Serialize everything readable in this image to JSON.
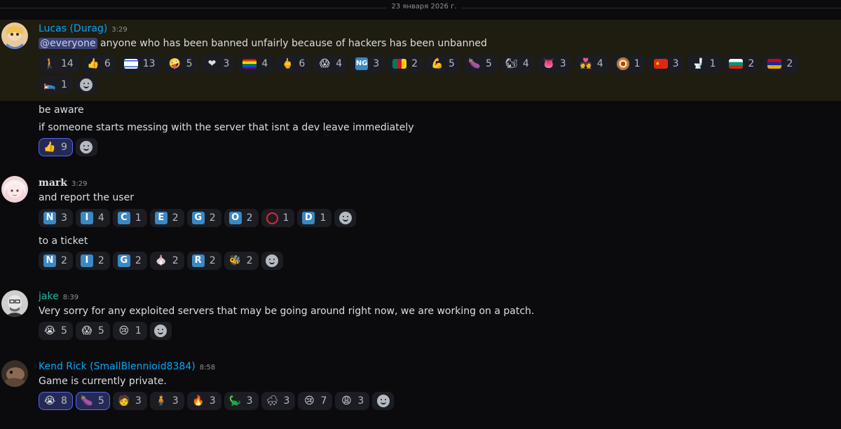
{
  "date_divider": "23 января 2026 г.",
  "colors": {
    "accent": "#5865f2",
    "highlight_bg": "#1f1c10",
    "user_blue": "#00a8fc",
    "user_green": "#1abc9c",
    "mark_color": "#dbdee1"
  },
  "messages": [
    {
      "author": "Lucas (Durag)",
      "time": "3:29",
      "avatar_icon": "avatar-lucas",
      "lines": [
        {
          "mention": "@everyone",
          "text": " anyone who has been banned unfairly because of hackers has been unbanned"
        }
      ],
      "reactions": [
        {
          "emoji": "person-walking-icon",
          "glyph": "🚶",
          "count": "14"
        },
        {
          "emoji": "thumbs-up-icon",
          "glyph": "👍",
          "count": "6"
        },
        {
          "emoji": "israel-flag-icon",
          "glyph": "",
          "count": "13"
        },
        {
          "emoji": "face-icon",
          "glyph": "🤪",
          "count": "5"
        },
        {
          "emoji": "heart-icon",
          "glyph": "❤",
          "count": "3"
        },
        {
          "emoji": "rainbow-flag-icon",
          "glyph": "",
          "count": "4"
        },
        {
          "emoji": "middle-finger-icon",
          "glyph": "🖕",
          "count": "6"
        },
        {
          "emoji": "screaming-face-icon",
          "glyph": "😱",
          "count": "4"
        },
        {
          "emoji": "ng-button-icon",
          "glyph": "NG",
          "count": "3"
        },
        {
          "emoji": "cameroon-flag-icon",
          "glyph": "",
          "count": "2"
        },
        {
          "emoji": "muscle-icon",
          "glyph": "💪",
          "count": "5"
        },
        {
          "emoji": "eggplant-icon",
          "glyph": "🍆",
          "count": "5"
        },
        {
          "emoji": "squirrel-icon",
          "glyph": "🐿",
          "count": "4"
        },
        {
          "emoji": "tongue-icon",
          "glyph": "👅",
          "count": "3"
        },
        {
          "emoji": "couple-heart-icon",
          "glyph": "💑",
          "count": "4"
        },
        {
          "emoji": "target-icon",
          "glyph": "◎",
          "count": "1"
        },
        {
          "emoji": "china-flag-icon",
          "glyph": "",
          "count": "3"
        },
        {
          "emoji": "toilet-icon",
          "glyph": "🚽",
          "count": "1"
        },
        {
          "emoji": "bulgaria-flag-icon",
          "glyph": "",
          "count": "2"
        },
        {
          "emoji": "armenia-flag-icon",
          "glyph": "",
          "count": "2"
        },
        {
          "emoji": "bed-icon",
          "glyph": "🛌",
          "count": "1"
        }
      ]
    },
    {
      "lines": [
        {
          "text": "be aware"
        },
        {
          "text": "if someone starts messing with the server that isnt a dev leave immediately"
        }
      ],
      "reactions": [
        {
          "emoji": "thumbs-up-icon",
          "glyph": "👍",
          "count": "9",
          "active": true
        }
      ]
    },
    {
      "author": "mark",
      "time": "3:29",
      "lines": [
        {
          "text": "and report the user"
        }
      ],
      "reactions": [
        {
          "emoji": "letter-n-icon",
          "glyph": "N",
          "count": "3"
        },
        {
          "emoji": "letter-i-icon",
          "glyph": "I",
          "count": "4"
        },
        {
          "emoji": "letter-c-icon",
          "glyph": "C",
          "count": "1"
        },
        {
          "emoji": "letter-e-icon",
          "glyph": "E",
          "count": "2"
        },
        {
          "emoji": "letter-g-icon",
          "glyph": "G",
          "count": "2"
        },
        {
          "emoji": "letter-o-icon",
          "glyph": "O",
          "count": "2"
        },
        {
          "emoji": "red-circle-icon",
          "glyph": "⭕",
          "count": "1"
        },
        {
          "emoji": "letter-d-icon",
          "glyph": "D",
          "count": "1"
        }
      ]
    },
    {
      "lines": [
        {
          "text": "to a ticket"
        }
      ],
      "reactions": [
        {
          "emoji": "letter-n-icon",
          "glyph": "N",
          "count": "2"
        },
        {
          "emoji": "letter-i-icon",
          "glyph": "I",
          "count": "2"
        },
        {
          "emoji": "letter-g-icon",
          "glyph": "G",
          "count": "2"
        },
        {
          "emoji": "garlic-icon",
          "glyph": "🧄",
          "count": "2"
        },
        {
          "emoji": "letter-r-icon",
          "glyph": "R",
          "count": "2"
        },
        {
          "emoji": "bee-icon",
          "glyph": "🐝",
          "count": "2"
        }
      ]
    },
    {
      "author": "jake",
      "time": "8:39",
      "lines": [
        {
          "text": "Very sorry for any exploited servers that may be going around right now, we are working on a patch."
        }
      ],
      "reactions": [
        {
          "emoji": "crying-face-icon",
          "glyph": "😭",
          "count": "5"
        },
        {
          "emoji": "screaming-face-icon",
          "glyph": "😱",
          "count": "5"
        },
        {
          "emoji": "sobbing-face-icon",
          "glyph": "😢",
          "count": "1"
        }
      ]
    },
    {
      "author": "Kend Rick (SmallBlennioid8384)",
      "time": "8:58",
      "lines": [
        {
          "text": "Game is currently private."
        }
      ],
      "reactions": [
        {
          "emoji": "crying-face-icon",
          "glyph": "😭",
          "count": "8",
          "active": true
        },
        {
          "emoji": "eggplant-icon",
          "glyph": "🍆",
          "count": "5",
          "active": true
        },
        {
          "emoji": "person-walking-cane-icon",
          "glyph": "🧑",
          "count": "3"
        },
        {
          "emoji": "person-icon",
          "glyph": "🧍",
          "count": "3"
        },
        {
          "emoji": "fire-icon",
          "glyph": "🔥",
          "count": "3"
        },
        {
          "emoji": "dinosaur-icon",
          "glyph": "🦕",
          "count": "3"
        },
        {
          "emoji": "cloud-snow-icon",
          "glyph": "🌨",
          "count": "3"
        },
        {
          "emoji": "sobbing-face-icon",
          "glyph": "😢",
          "count": "7"
        },
        {
          "emoji": "weary-face-icon",
          "glyph": "😩",
          "count": "3"
        }
      ]
    }
  ]
}
